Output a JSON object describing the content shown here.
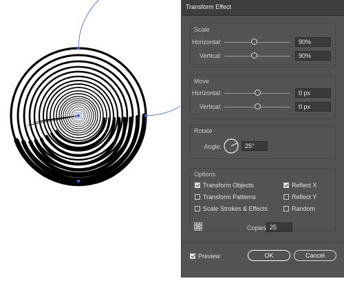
{
  "dialog": {
    "title": "Transform Effect",
    "scale": {
      "section_label": "Scale",
      "horizontal_label": "Horizontal:",
      "horizontal_value": "90%",
      "vertical_label": "Vertical:",
      "vertical_value": "90%"
    },
    "move": {
      "section_label": "Move",
      "horizontal_label": "Horizontal:",
      "horizontal_value": "0 px",
      "vertical_label": "Vertical:",
      "vertical_value": "0 px"
    },
    "rotate": {
      "section_label": "Rotate",
      "angle_label": "Angle:",
      "angle_value": "25°"
    },
    "options": {
      "section_label": "Options",
      "transform_objects": "Transform Objects",
      "transform_patterns": "Transform Patterns",
      "scale_strokes": "Scale Strokes & Effects",
      "reflect_x": "Reflect X",
      "reflect_y": "Reflect Y",
      "random": "Random",
      "copies_label": "Copies",
      "copies_value": "25"
    },
    "preview_label": "Preview",
    "ok_label": "OK",
    "cancel_label": "Cancel"
  },
  "colors": {
    "dialog_bg": "#535353",
    "titlebar_bg": "#3e3e3e",
    "selection_blue": "#3d5bd9"
  },
  "states": {
    "transform_objects": true,
    "transform_patterns": false,
    "scale_strokes": false,
    "reflect_x": true,
    "reflect_y": false,
    "random": false,
    "preview": true
  }
}
